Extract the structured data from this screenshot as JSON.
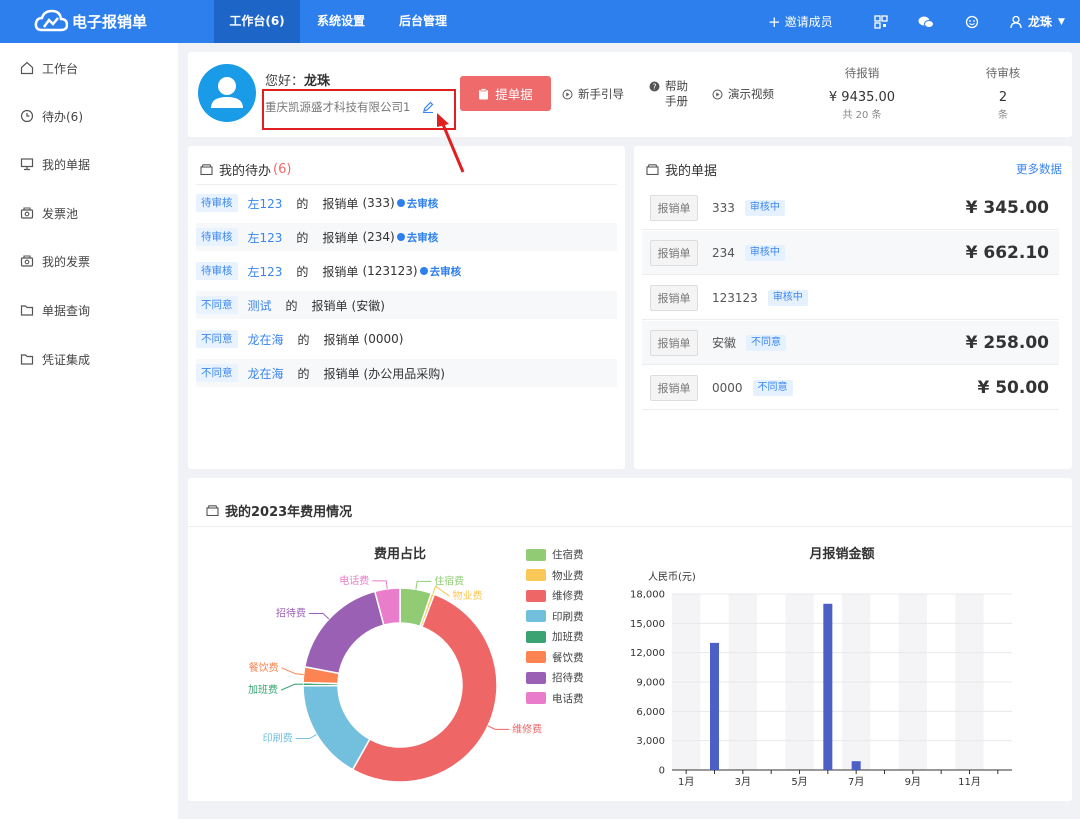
{
  "app": {
    "title": "电子报销单"
  },
  "nav": {
    "items": [
      {
        "label": "工作台(6)"
      },
      {
        "label": "系统设置"
      },
      {
        "label": "后台管理"
      }
    ]
  },
  "topright": {
    "invite": "邀请成员",
    "user": "龙珠"
  },
  "sidebar": {
    "items": [
      {
        "label": "工作台"
      },
      {
        "label": "待办(6)"
      },
      {
        "label": "我的单据"
      },
      {
        "label": "发票池"
      },
      {
        "label": "我的发票"
      },
      {
        "label": "单据查询"
      },
      {
        "label": "凭证集成"
      }
    ]
  },
  "profile": {
    "greeting": "您好：",
    "name": "龙珠",
    "company": "重庆凯源盛才科技有限公司1"
  },
  "actions": {
    "submit": "提单据",
    "guide": "新手引导",
    "help": "帮助\n手册",
    "video": "演示视频"
  },
  "stats": {
    "pending_pay_label": "待报销",
    "pending_pay_value": "¥ 9435.00",
    "pending_pay_sub": "共 20 条",
    "pending_review_label": "待审核",
    "pending_review_value": "2",
    "pending_review_sub": "条"
  },
  "todo": {
    "title": "我的待办",
    "count": "(6)",
    "of": "的",
    "type": "报销单",
    "go": "去审核",
    "rows": [
      {
        "tag": "待审核",
        "user": "左123",
        "doc": "(333)",
        "action": true
      },
      {
        "tag": "待审核",
        "user": "左123",
        "doc": "(234)",
        "action": true
      },
      {
        "tag": "待审核",
        "user": "左123",
        "doc": "(123123)",
        "action": true
      },
      {
        "tag": "不同意",
        "user": "测试",
        "doc": "(安徽)",
        "action": false
      },
      {
        "tag": "不同意",
        "user": "龙在海",
        "doc": "(0000)",
        "action": false
      },
      {
        "tag": "不同意",
        "user": "龙在海",
        "doc": "(办公用品采购)",
        "action": false
      }
    ]
  },
  "bills": {
    "title": "我的单据",
    "more": "更多数据",
    "type": "报销单",
    "rows": [
      {
        "no": "333",
        "status": "审核中",
        "amount": "¥ 345.00"
      },
      {
        "no": "234",
        "status": "审核中",
        "amount": "¥ 662.10"
      },
      {
        "no": "123123",
        "status": "审核中",
        "amount": ""
      },
      {
        "no": "安徽",
        "status": "不同意",
        "amount": "¥ 258.00"
      },
      {
        "no": "0000",
        "status": "不同意",
        "amount": "¥ 50.00"
      }
    ]
  },
  "expense": {
    "title": "我的2023年费用情况"
  },
  "chart_data": [
    {
      "type": "pie",
      "title": "费用占比",
      "categories": [
        "住宿费",
        "物业费",
        "维修费",
        "印刷费",
        "加班费",
        "餐饮费",
        "招待费",
        "电话费"
      ],
      "values": [
        5,
        0.5,
        50,
        16,
        0.5,
        2.5,
        17,
        4
      ],
      "colors": [
        "#91cc75",
        "#fac858",
        "#ee6666",
        "#73c0de",
        "#3ba272",
        "#fc8452",
        "#9a60b4",
        "#ea7ccc"
      ]
    },
    {
      "type": "bar",
      "title": "月报销金额",
      "ylabel": "人民币(元)",
      "categories": [
        "1月",
        "2月",
        "3月",
        "4月",
        "5月",
        "6月",
        "7月",
        "8月",
        "9月",
        "10月",
        "11月",
        "12月"
      ],
      "values": [
        0,
        13000,
        0,
        0,
        0,
        17000,
        900,
        0,
        0,
        0,
        0,
        0
      ],
      "ylim": [
        0,
        18000
      ],
      "yticks": [
        "18,000",
        "15,000",
        "12,000",
        "9,000",
        "6,000",
        "3,000",
        "0"
      ],
      "xticks": [
        "1月",
        "3月",
        "5月",
        "7月",
        "9月",
        "11月"
      ],
      "color": "#4b5fc6"
    }
  ]
}
